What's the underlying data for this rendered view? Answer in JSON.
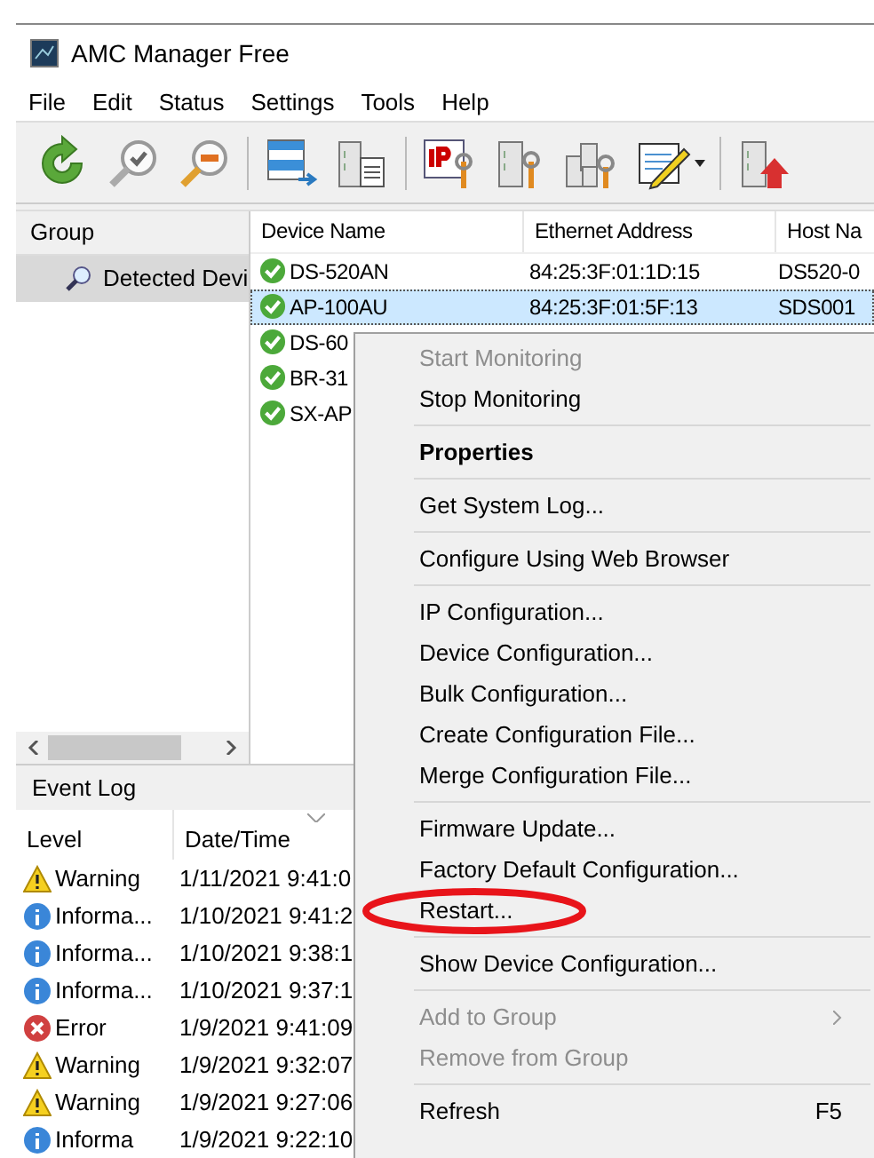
{
  "window": {
    "title": "AMC Manager Free"
  },
  "menu_bar": [
    "File",
    "Edit",
    "Status",
    "Settings",
    "Tools",
    "Help"
  ],
  "group_panel": {
    "header": "Group",
    "items": [
      {
        "label": "Detected Devi",
        "selected": true
      }
    ]
  },
  "device_list": {
    "columns": [
      "Device Name",
      "Ethernet Address",
      "Host Na"
    ],
    "rows": [
      {
        "selected": false,
        "cells": [
          "DS-520AN",
          "84:25:3F:01:1D:15",
          "DS520-0"
        ]
      },
      {
        "selected": true,
        "cells": [
          "AP-100AU",
          "84:25:3F:01:5F:13",
          "SDS001"
        ]
      },
      {
        "selected": false,
        "cells": [
          "DS-60",
          "",
          ""
        ]
      },
      {
        "selected": false,
        "cells": [
          "BR-31",
          "",
          ""
        ]
      },
      {
        "selected": false,
        "cells": [
          "SX-AP",
          "",
          ""
        ]
      }
    ]
  },
  "event_log": {
    "title": "Event Log",
    "columns": [
      "Level",
      "Date/Time"
    ],
    "rows": [
      {
        "kind": "warning",
        "level": "Warning",
        "date": "1/11/2021 9:41:0"
      },
      {
        "kind": "info",
        "level": "Informa...",
        "date": "1/10/2021 9:41:2"
      },
      {
        "kind": "info",
        "level": "Informa...",
        "date": "1/10/2021 9:38:1"
      },
      {
        "kind": "info",
        "level": "Informa...",
        "date": "1/10/2021 9:37:1"
      },
      {
        "kind": "error",
        "level": "Error",
        "date": "1/9/2021 9:41:09"
      },
      {
        "kind": "warning",
        "level": "Warning",
        "date": "1/9/2021 9:32:07"
      },
      {
        "kind": "warning",
        "level": "Warning",
        "date": "1/9/2021 9:27:06"
      },
      {
        "kind": "info",
        "level": "Informa",
        "date": "1/9/2021 9:22:10"
      }
    ]
  },
  "context_menu": [
    {
      "kind": "item",
      "label": "Start Monitoring",
      "disabled": true
    },
    {
      "kind": "item",
      "label": "Stop Monitoring",
      "disabled": false
    },
    {
      "kind": "separator"
    },
    {
      "kind": "item",
      "label": "Properties",
      "disabled": false,
      "bold": true
    },
    {
      "kind": "separator"
    },
    {
      "kind": "item",
      "label": "Get System Log...",
      "disabled": false
    },
    {
      "kind": "separator"
    },
    {
      "kind": "item",
      "label": "Configure Using Web Browser",
      "disabled": false
    },
    {
      "kind": "separator"
    },
    {
      "kind": "item",
      "label": "IP Configuration...",
      "disabled": false
    },
    {
      "kind": "item",
      "label": "Device Configuration...",
      "disabled": false
    },
    {
      "kind": "item",
      "label": "Bulk Configuration...",
      "disabled": false
    },
    {
      "kind": "item",
      "label": "Create Configuration File...",
      "disabled": false
    },
    {
      "kind": "item",
      "label": "Merge Configuration File...",
      "disabled": false
    },
    {
      "kind": "separator"
    },
    {
      "kind": "item",
      "label": "Firmware Update...",
      "disabled": false
    },
    {
      "kind": "item",
      "label": "Factory Default Configuration...",
      "disabled": false
    },
    {
      "kind": "item",
      "label": "Restart...",
      "disabled": false,
      "circled": true
    },
    {
      "kind": "separator"
    },
    {
      "kind": "item",
      "label": "Show Device Configuration...",
      "disabled": false
    },
    {
      "kind": "separator"
    },
    {
      "kind": "item",
      "label": "Add to Group",
      "disabled": true,
      "submenu": true
    },
    {
      "kind": "item",
      "label": "Remove from Group",
      "disabled": true
    },
    {
      "kind": "separator"
    },
    {
      "kind": "item",
      "label": "Refresh",
      "disabled": false,
      "shortcut": "F5"
    }
  ]
}
